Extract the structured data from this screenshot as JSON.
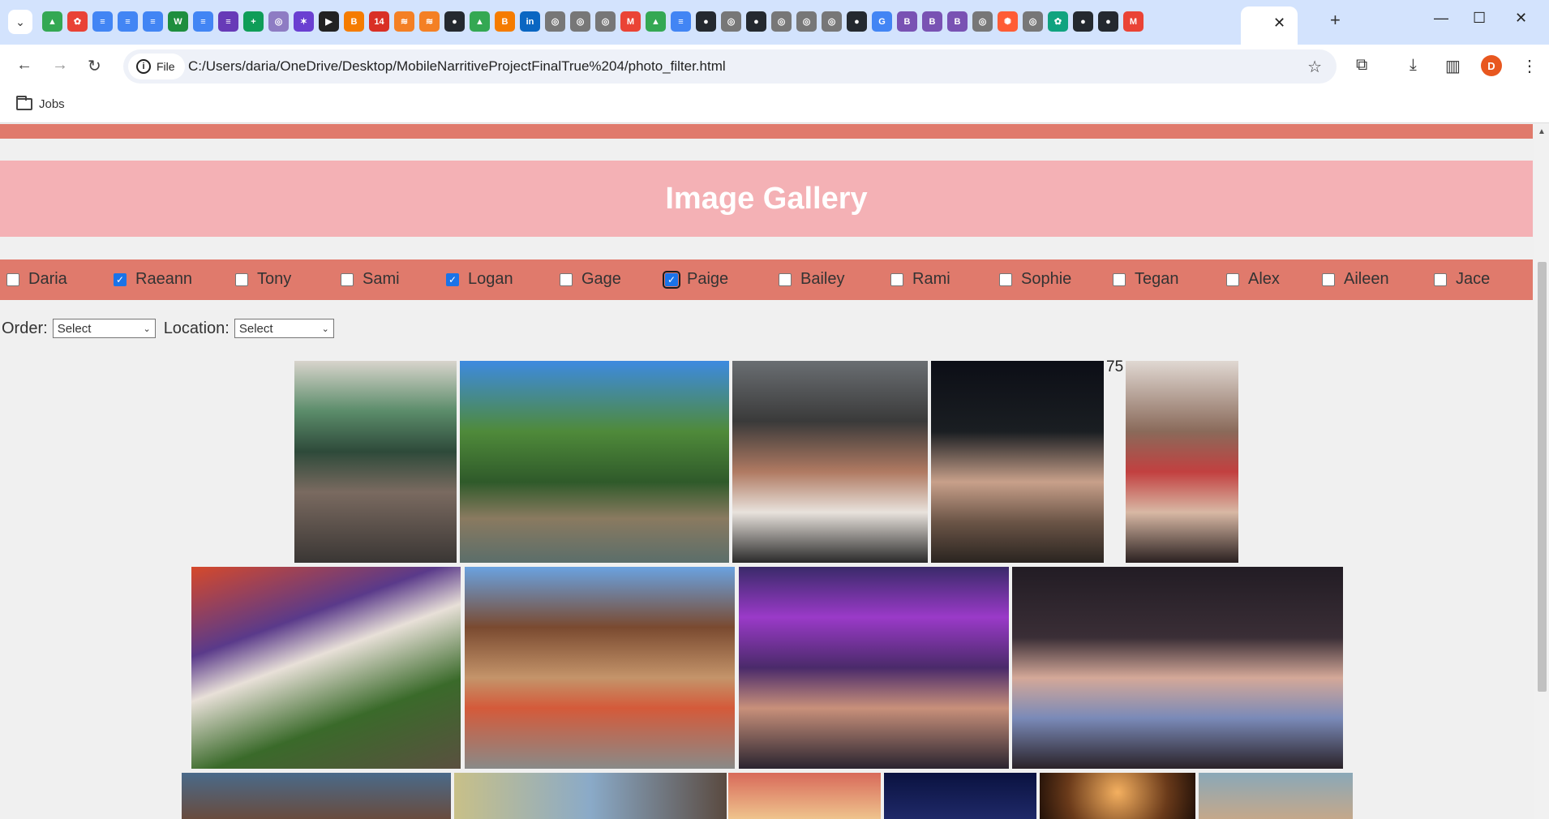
{
  "browser": {
    "url": "C:/Users/daria/OneDrive/Desktop/MobileNarritiveProjectFinalTrue%204/photo_filter.html",
    "file_chip_label": "File",
    "bookmark_folder": "Jobs",
    "profile_initial": "D"
  },
  "page": {
    "title": "Image Gallery",
    "filters": [
      {
        "name": "Daria",
        "checked": false
      },
      {
        "name": "Raeann",
        "checked": true
      },
      {
        "name": "Tony",
        "checked": false
      },
      {
        "name": "Sami",
        "checked": false
      },
      {
        "name": "Logan",
        "checked": true
      },
      {
        "name": "Gage",
        "checked": false
      },
      {
        "name": "Paige",
        "checked": true
      },
      {
        "name": "Bailey",
        "checked": false
      },
      {
        "name": "Rami",
        "checked": false
      },
      {
        "name": "Sophie",
        "checked": false
      },
      {
        "name": "Tegan",
        "checked": false
      },
      {
        "name": "Alex",
        "checked": false
      },
      {
        "name": "Aileen",
        "checked": false
      },
      {
        "name": "Jace",
        "checked": false
      }
    ],
    "order_label": "Order:",
    "order_value": "Select",
    "location_label": "Location:",
    "location_value": "Select",
    "stray_text": "75"
  }
}
